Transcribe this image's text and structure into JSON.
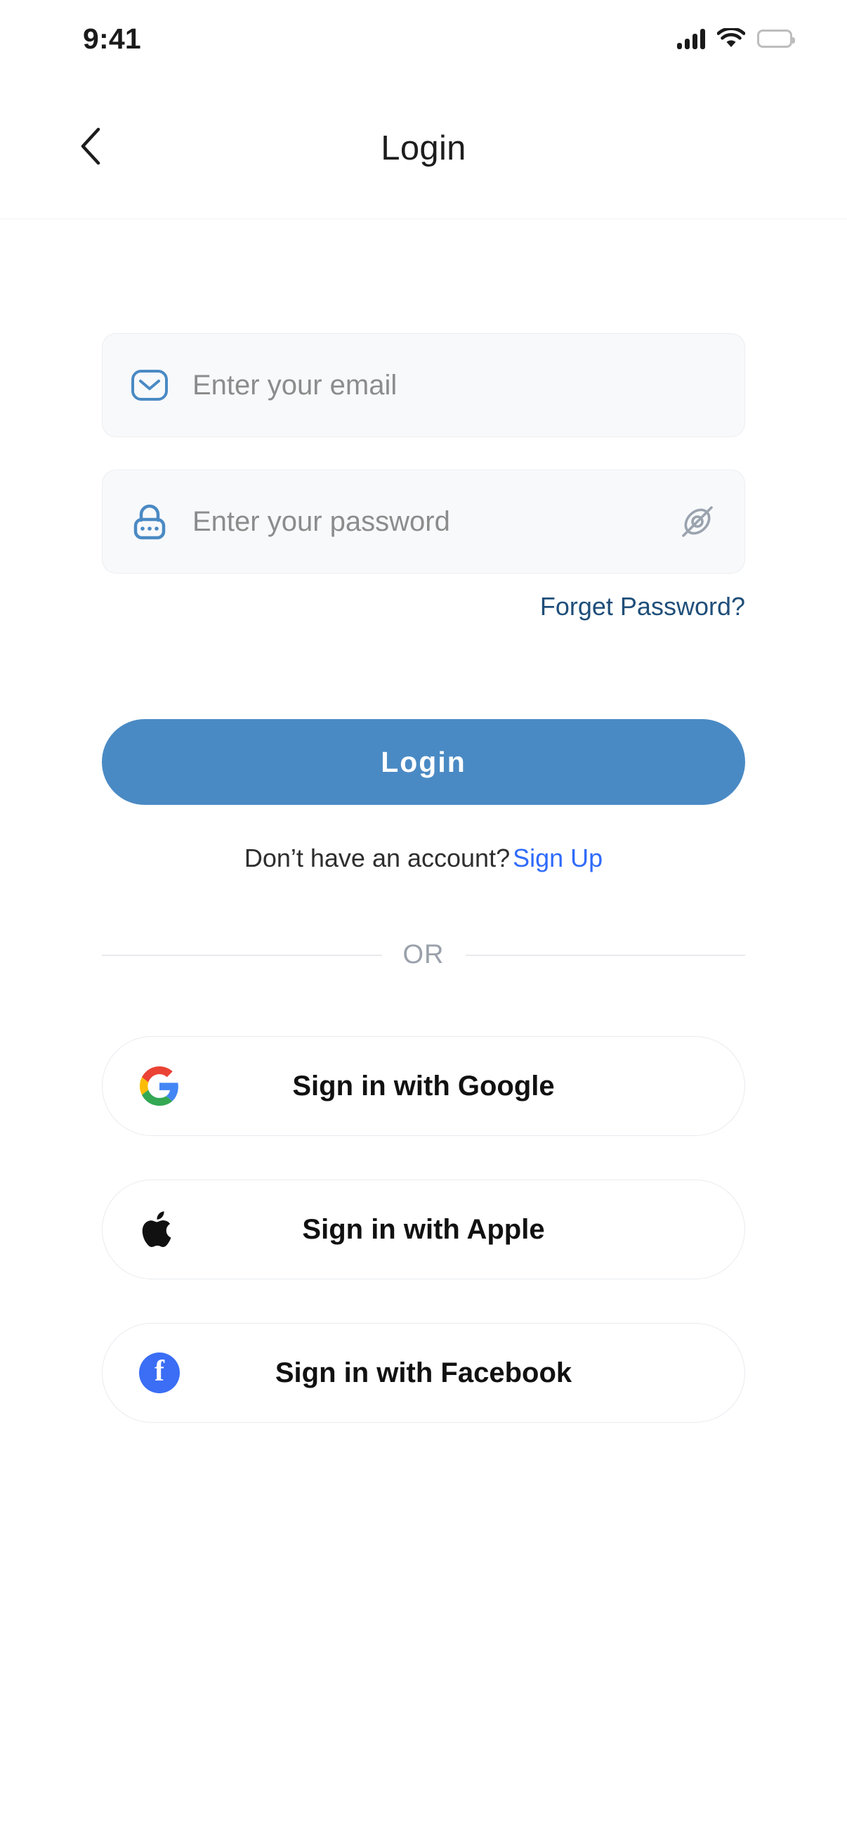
{
  "status_bar": {
    "time": "9:41",
    "cellular_icon": "cellular-signal-icon",
    "wifi_icon": "wifi-icon",
    "battery_icon": "battery-full-icon"
  },
  "header": {
    "back_icon": "chevron-left-icon",
    "title": "Login"
  },
  "form": {
    "email": {
      "icon": "envelope-icon",
      "placeholder": "Enter your email",
      "value": ""
    },
    "password": {
      "icon": "padlock-icon",
      "placeholder": "Enter your password",
      "value": "",
      "toggle_icon": "eye-off-icon"
    },
    "forget_password_label": "Forget Password?",
    "login_button_label": "Login",
    "signup_prompt": "Don’t have an account?",
    "signup_link_label": "Sign Up",
    "divider_label": "OR"
  },
  "social": [
    {
      "id": "google",
      "icon": "google-logo-icon",
      "label": "Sign in with Google"
    },
    {
      "id": "apple",
      "icon": "apple-logo-icon",
      "label": "Sign in with Apple"
    },
    {
      "id": "facebook",
      "icon": "facebook-logo-icon",
      "label": "Sign in with Facebook"
    }
  ],
  "colors": {
    "primary_blue": "#4a8ac4",
    "link_blue": "#2f6bfb",
    "forget_link": "#1f4e79",
    "field_bg": "#f8f9fb",
    "field_border": "#eceef1",
    "divider": "#e8eaee",
    "placeholder": "#8c8c8c",
    "facebook_blue": "#3b6ef5"
  }
}
